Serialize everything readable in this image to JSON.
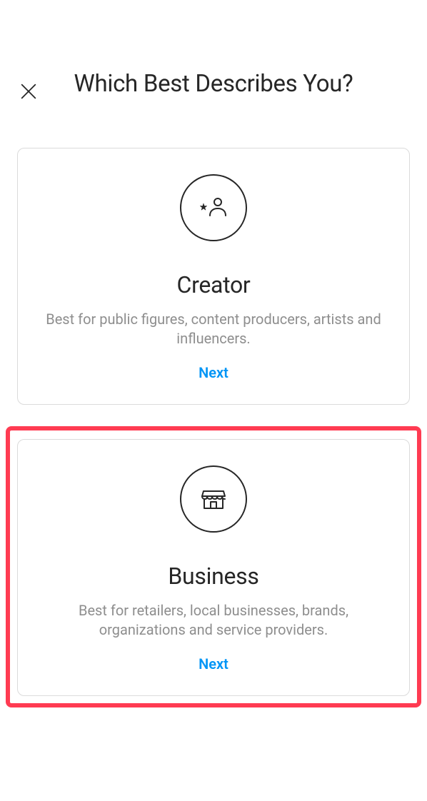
{
  "header": {
    "title": "Which Best Describes You?"
  },
  "cards": {
    "creator": {
      "title": "Creator",
      "description": "Best for public figures, content producers, artists and influencers.",
      "action": "Next"
    },
    "business": {
      "title": "Business",
      "description": "Best for retailers, local businesses, brands, organizations and service providers.",
      "action": "Next"
    }
  }
}
